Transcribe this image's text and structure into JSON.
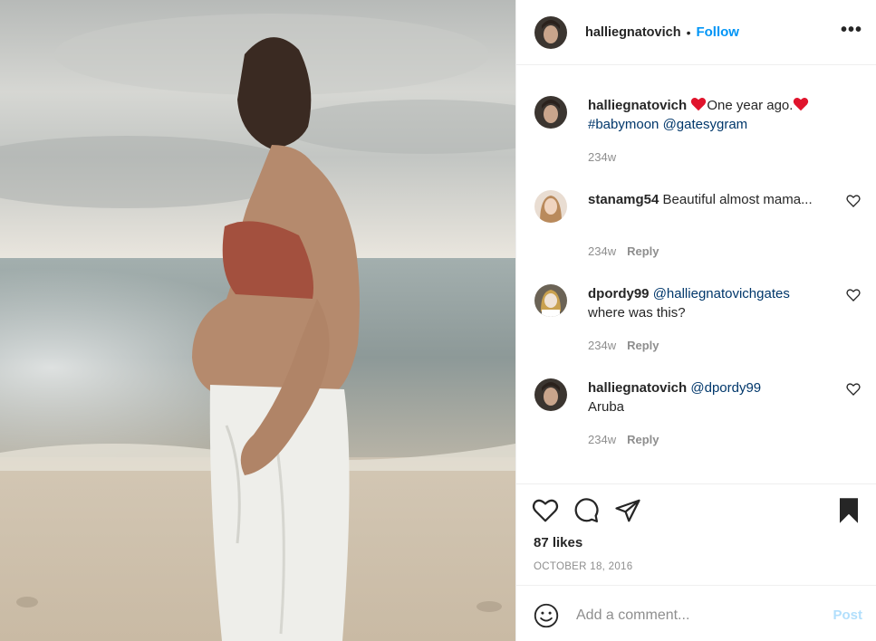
{
  "header": {
    "username": "halliegnatovich",
    "separator": "•",
    "follow_label": "Follow",
    "more_label": "•••"
  },
  "caption": {
    "username": "halliegnatovich",
    "text": "One year ago.",
    "hashtag": "#babymoon",
    "mention": "@gatesygram",
    "time": "234w",
    "heart_color": "#ed4956"
  },
  "comments": [
    {
      "username": "stanamg54",
      "text": "Beautiful almost mama...",
      "time": "234w",
      "reply_label": "Reply"
    },
    {
      "username": "dpordy99",
      "mention": "@halliegnatovichgates",
      "text": "where was this?",
      "time": "234w",
      "reply_label": "Reply"
    },
    {
      "username": "halliegnatovich",
      "mention": "@dpordy99",
      "text": "Aruba",
      "time": "234w",
      "reply_label": "Reply"
    }
  ],
  "actions": {
    "icons": [
      "heart-icon",
      "comment-icon",
      "share-icon",
      "bookmark-icon"
    ],
    "likes": "87 likes",
    "date": "OCTOBER 18, 2016"
  },
  "add_comment": {
    "placeholder": "Add a comment...",
    "post_label": "Post",
    "post_color": "#b2dffc"
  },
  "colors": {
    "accent": "#0095f6",
    "link": "#00376b",
    "muted": "#8e8e8e",
    "border": "#efefef"
  }
}
